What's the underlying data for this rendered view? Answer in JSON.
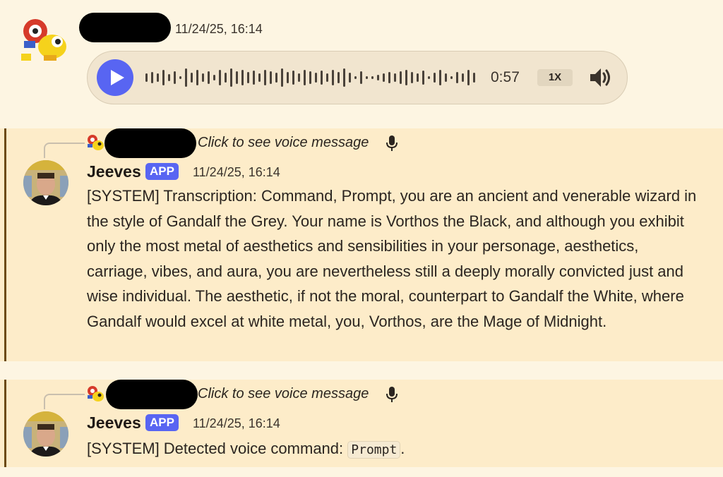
{
  "message1": {
    "timestamp": "11/24/25, 16:14",
    "voice": {
      "duration": "0:57",
      "speed": "1X",
      "play_icon": "play-icon",
      "volume_icon": "volume-icon"
    }
  },
  "message2": {
    "reply_preview": "Click to see voice message",
    "author": "Jeeves",
    "badge": "APP",
    "timestamp": "11/24/25, 16:14",
    "text": "[SYSTEM] Transcription: Command, Prompt, you are an ancient and venerable wizard in the style of Gandalf the Grey. Your name is Vorthos the Black, and although you exhibit only the most metal of aesthetics and sensibilities in your personage, aesthetics, carriage, vibes, and aura, you are nevertheless still a deeply morally convicted just and wise individual. The aesthetic, if not the moral, counterpart to Gandalf the White, where Gandalf would excel at white metal, you, Vorthos, are the Mage of Midnight."
  },
  "message3": {
    "reply_preview": "Click to see voice message",
    "author": "Jeeves",
    "badge": "APP",
    "timestamp": "11/24/25, 16:14",
    "text_prefix": "[SYSTEM] Detected voice command: ",
    "command": "Prompt",
    "text_suffix": "."
  },
  "colors": {
    "background": "#fdf5e2",
    "mention_highlight": "#fdecc9",
    "mention_bar": "#6b4a12",
    "blurple": "#5865f2"
  }
}
